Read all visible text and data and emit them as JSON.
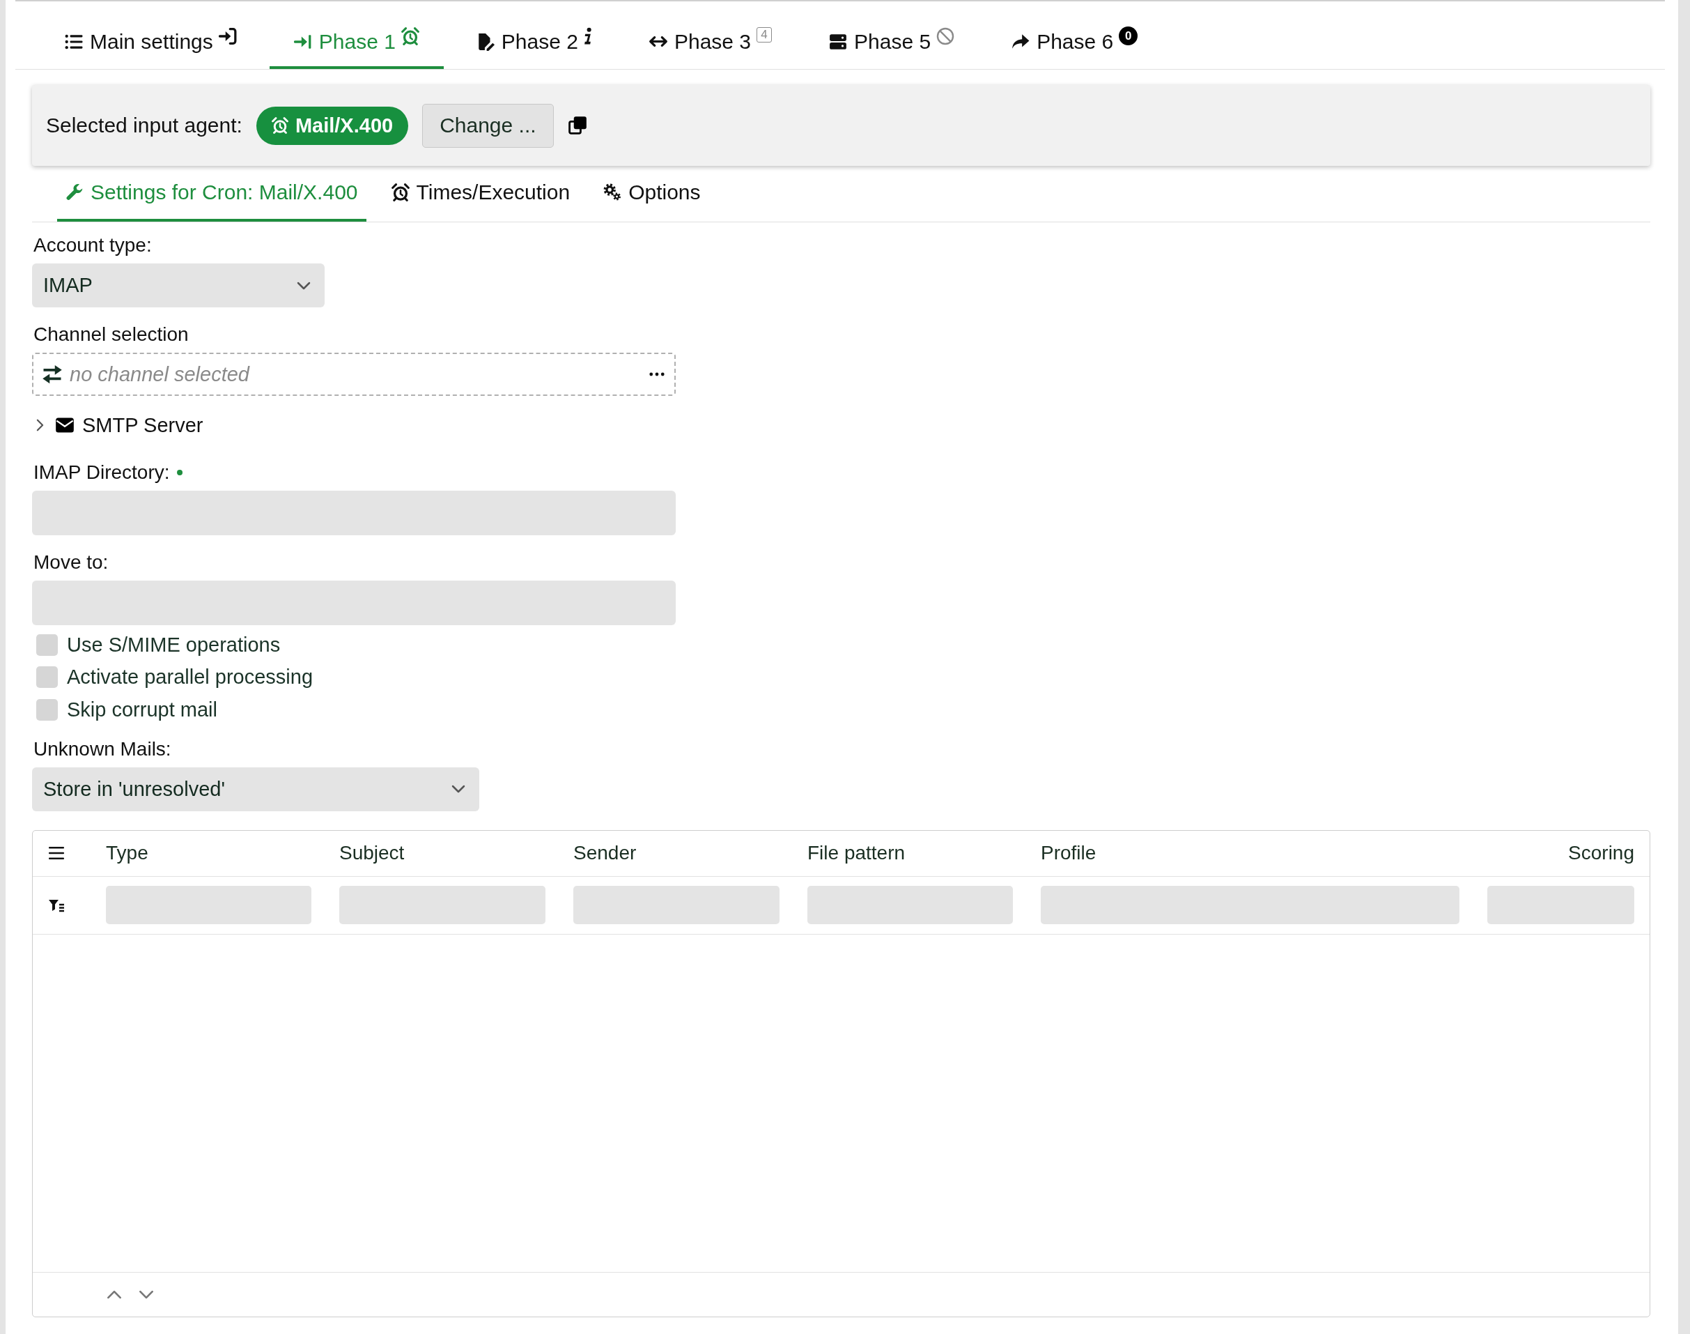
{
  "tabs": [
    {
      "label": "Main settings",
      "selected": false,
      "badge": {
        "kind": "icon"
      }
    },
    {
      "label": "Phase 1",
      "selected": true,
      "badge": {
        "kind": "icon"
      }
    },
    {
      "label": "Phase 2",
      "selected": false,
      "badge": {
        "kind": "icon"
      }
    },
    {
      "label": "Phase 3",
      "selected": false,
      "badge": {
        "kind": "square",
        "text": "4"
      }
    },
    {
      "label": "Phase 5",
      "selected": false,
      "badge": {
        "kind": "icon"
      }
    },
    {
      "label": "Phase 6",
      "selected": false,
      "badge": {
        "kind": "circle",
        "text": "0"
      }
    }
  ],
  "agent_bar": {
    "label": "Selected input agent:",
    "agent": "Mail/X.400",
    "change_button": "Change ..."
  },
  "subtabs": [
    {
      "label": "Settings for Cron: Mail/X.400",
      "selected": true
    },
    {
      "label": "Times/Execution",
      "selected": false
    },
    {
      "label": "Options",
      "selected": false
    }
  ],
  "fields": [
    {
      "kind": "select",
      "label": "Account type:",
      "value": "IMAP"
    },
    {
      "kind": "channel",
      "label": "Channel selection",
      "placeholder": "no channel selected"
    },
    {
      "kind": "section",
      "label": "SMTP Server",
      "expanded": false
    },
    {
      "kind": "text",
      "label": "IMAP Directory:",
      "required": true
    },
    {
      "kind": "text",
      "label": "Move to:"
    },
    {
      "kind": "checkbox",
      "label": "Use S/MIME operations",
      "checked": false
    },
    {
      "kind": "checkbox",
      "label": "Activate parallel processing",
      "checked": false
    },
    {
      "kind": "checkbox",
      "label": "Skip corrupt mail",
      "checked": false
    },
    {
      "kind": "select",
      "label": "Unknown Mails:",
      "value": "Store in 'unresolved'"
    }
  ],
  "table": {
    "columns": [
      "Type",
      "Subject",
      "Sender",
      "File pattern",
      "Profile",
      "Scoring"
    ]
  }
}
